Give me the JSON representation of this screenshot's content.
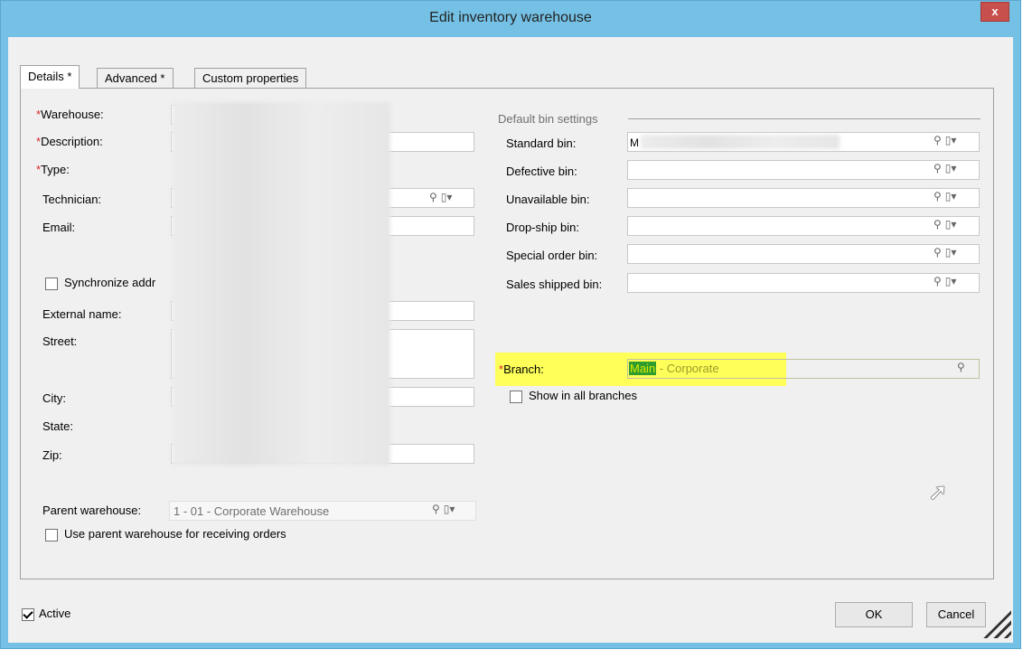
{
  "window": {
    "title": "Edit inventory warehouse",
    "close_label": "x"
  },
  "tabs": [
    {
      "label": "Details *"
    },
    {
      "label": "Advanced *"
    },
    {
      "label": "Custom properties"
    }
  ],
  "left": {
    "warehouse_label": "Warehouse:",
    "description_label": "Description:",
    "type_label": "Type:",
    "technician_label": "Technician:",
    "email_label": "Email:",
    "sync_label": "Synchronize addr",
    "external_name_label": "External name:",
    "street_label": "Street:",
    "city_label": "City:",
    "state_label": "State:",
    "zip_label": "Zip:",
    "parent_warehouse_label": "Parent warehouse:",
    "parent_warehouse_value": "1 - 01 - Corporate Warehouse",
    "use_parent_label": "Use parent warehouse for receiving orders",
    "required_mark": "*"
  },
  "bins": {
    "section_title": "Default bin settings",
    "standard_label": "Standard bin:",
    "standard_value": "M",
    "defective_label": "Defective bin:",
    "unavailable_label": "Unavailable bin:",
    "dropship_label": "Drop-ship bin:",
    "special_label": "Special order bin:",
    "sales_shipped_label": "Sales shipped bin:"
  },
  "branch": {
    "label": "Branch:",
    "value_code": "Main",
    "value_desc": " - Corporate",
    "show_all_label": "Show in all branches"
  },
  "footer": {
    "active_label": "Active",
    "ok_label": "OK",
    "cancel_label": "Cancel"
  },
  "icons": {
    "lookup": "⚲",
    "dropdown": "▾"
  },
  "colors": {
    "title_bar": "#75c1e6",
    "close_button": "#c7504d",
    "required": "#d8262c",
    "highlight": "#ffff5a",
    "selection": "#2e9d2e"
  }
}
